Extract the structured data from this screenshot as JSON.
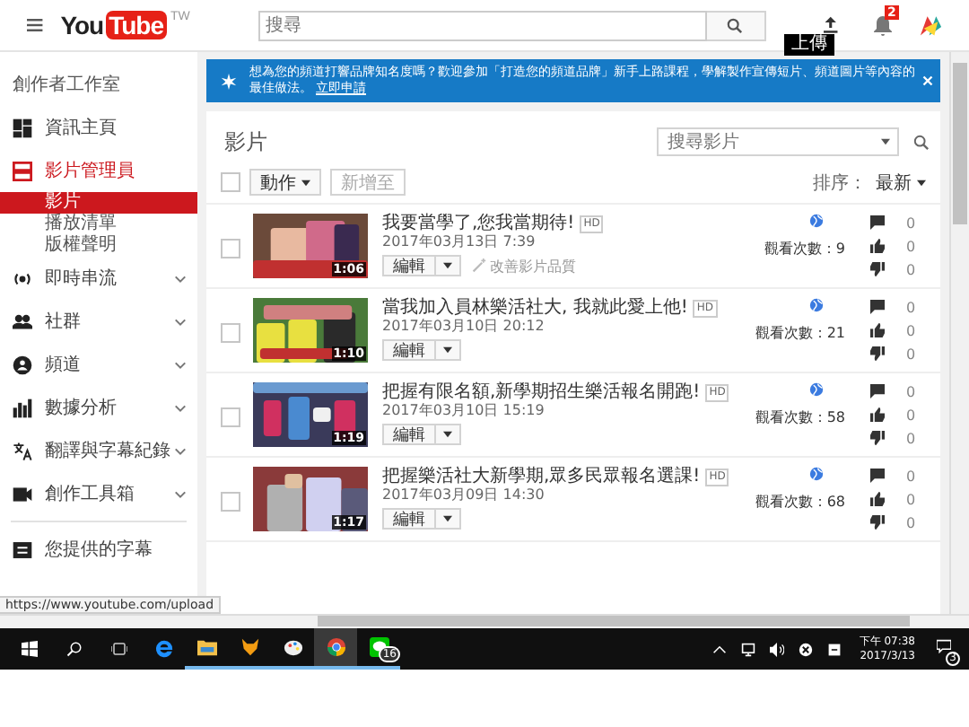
{
  "header": {
    "logo": "YouTube",
    "region": "TW",
    "search": {
      "placeholder": "搜尋"
    },
    "upload_tooltip": "上傳",
    "notification_count": "2"
  },
  "banner": {
    "text": "想為您的頻道打響品牌知名度嗎？歡迎參加「打造您的頻道品牌」新手上路課程，學解製作宣傳短片、頻道圖片等內容的最佳做法。",
    "link": "立即申請"
  },
  "sidebar": {
    "title": "創作者工作室",
    "items": [
      {
        "label": "資訊主頁",
        "selected": false,
        "expandable": false
      },
      {
        "label": "影片管理員",
        "selected": true,
        "expandable": false,
        "children": [
          {
            "label": "影片",
            "selected": true
          },
          {
            "label": "播放清單",
            "selected": false
          },
          {
            "label": "版權聲明",
            "selected": false
          }
        ]
      },
      {
        "label": "即時串流",
        "selected": false,
        "expandable": true
      },
      {
        "label": "社群",
        "selected": false,
        "expandable": true
      },
      {
        "label": "頻道",
        "selected": false,
        "expandable": true
      },
      {
        "label": "數據分析",
        "selected": false,
        "expandable": true
      },
      {
        "label": "翻譯與字幕紀錄",
        "selected": false,
        "expandable": true
      },
      {
        "label": "創作工具箱",
        "selected": false,
        "expandable": true
      }
    ],
    "footer_item": "您提供的字幕"
  },
  "videos": {
    "title": "影片",
    "select_all": {
      "checked": false
    },
    "search": {
      "placeholder": "搜尋影片"
    },
    "actions_button": "動作",
    "add_to_button": {
      "label": "新增至",
      "disabled": true
    },
    "sort_label": "排序：",
    "sort_value": "最新",
    "rows": [
      {
        "checked": false,
        "title": "我要當學了,您我當期待!",
        "hd": "HD",
        "date": "2017年03月13日 7:39",
        "duration": "1:06",
        "edit": "編輯",
        "enhance": "改善影片品質",
        "views": "觀看次數：9",
        "comments": "0",
        "likes": "0",
        "dislikes": "0"
      },
      {
        "checked": false,
        "title": "當我加入員林樂活社大, 我就此愛上他!",
        "hd": "HD",
        "date": "2017年03月10日 20:12",
        "duration": "1:10",
        "edit": "編輯",
        "views": "觀看次數：21",
        "comments": "0",
        "likes": "0",
        "dislikes": "0"
      },
      {
        "checked": false,
        "title": "把握有限名額,新學期招生樂活報名開跑!",
        "hd": "HD",
        "date": "2017年03月10日 15:19",
        "duration": "1:19",
        "edit": "編輯",
        "views": "觀看次數：58",
        "comments": "0",
        "likes": "0",
        "dislikes": "0"
      },
      {
        "checked": false,
        "title": "把握樂活社大新學期,眾多民眾報名選課!",
        "hd": "HD",
        "date": "2017年03月09日 14:30",
        "duration": "1:17",
        "edit": "編輯",
        "views": "觀看次數：68",
        "comments": "0",
        "likes": "0",
        "dislikes": "0"
      }
    ]
  },
  "status_url": "https://www.youtube.com/upload",
  "taskbar": {
    "apps": [
      {
        "selected": false,
        "running": false
      },
      {
        "selected": false,
        "running": true
      },
      {
        "selected": false,
        "running": true
      },
      {
        "selected": false,
        "running": true
      },
      {
        "selected": true,
        "running": true
      },
      {
        "selected": false,
        "running": true,
        "badge": "16"
      }
    ],
    "time": "下午 07:38",
    "date": "2017/3/13",
    "notification_count": "3"
  }
}
